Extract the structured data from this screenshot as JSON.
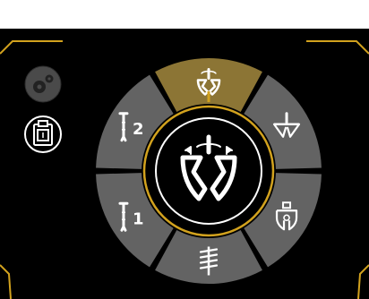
{
  "colors": {
    "top_bar": "#ffffff",
    "panel": "#000000",
    "accent": "#d2a21e",
    "ring_segment": "#636363",
    "active_segment": "#8c7535",
    "disabled_button": "#4a4a4a",
    "icon": "#ffffff"
  },
  "side_buttons": [
    {
      "name": "settings",
      "icon": "gears-icon",
      "state": "disabled"
    },
    {
      "name": "clipboard",
      "icon": "clipboard-icon",
      "state": "enabled"
    }
  ],
  "center": {
    "icon": "rotating-gripper-icon"
  },
  "ring_segments": [
    {
      "position": "top",
      "icon": "rotate-gripper-icon",
      "label": "",
      "active": true
    },
    {
      "position": "upper-right",
      "icon": "open-gripper-icon",
      "label": "",
      "active": false
    },
    {
      "position": "lower-right",
      "icon": "claw-gripper-icon",
      "label": "",
      "active": false
    },
    {
      "position": "bottom",
      "icon": "spring-coil-icon",
      "label": "",
      "active": false
    },
    {
      "position": "lower-left",
      "icon": "tool-1-icon",
      "label": "1",
      "active": false
    },
    {
      "position": "upper-left",
      "icon": "tool-2-icon",
      "label": "2",
      "active": false
    }
  ]
}
